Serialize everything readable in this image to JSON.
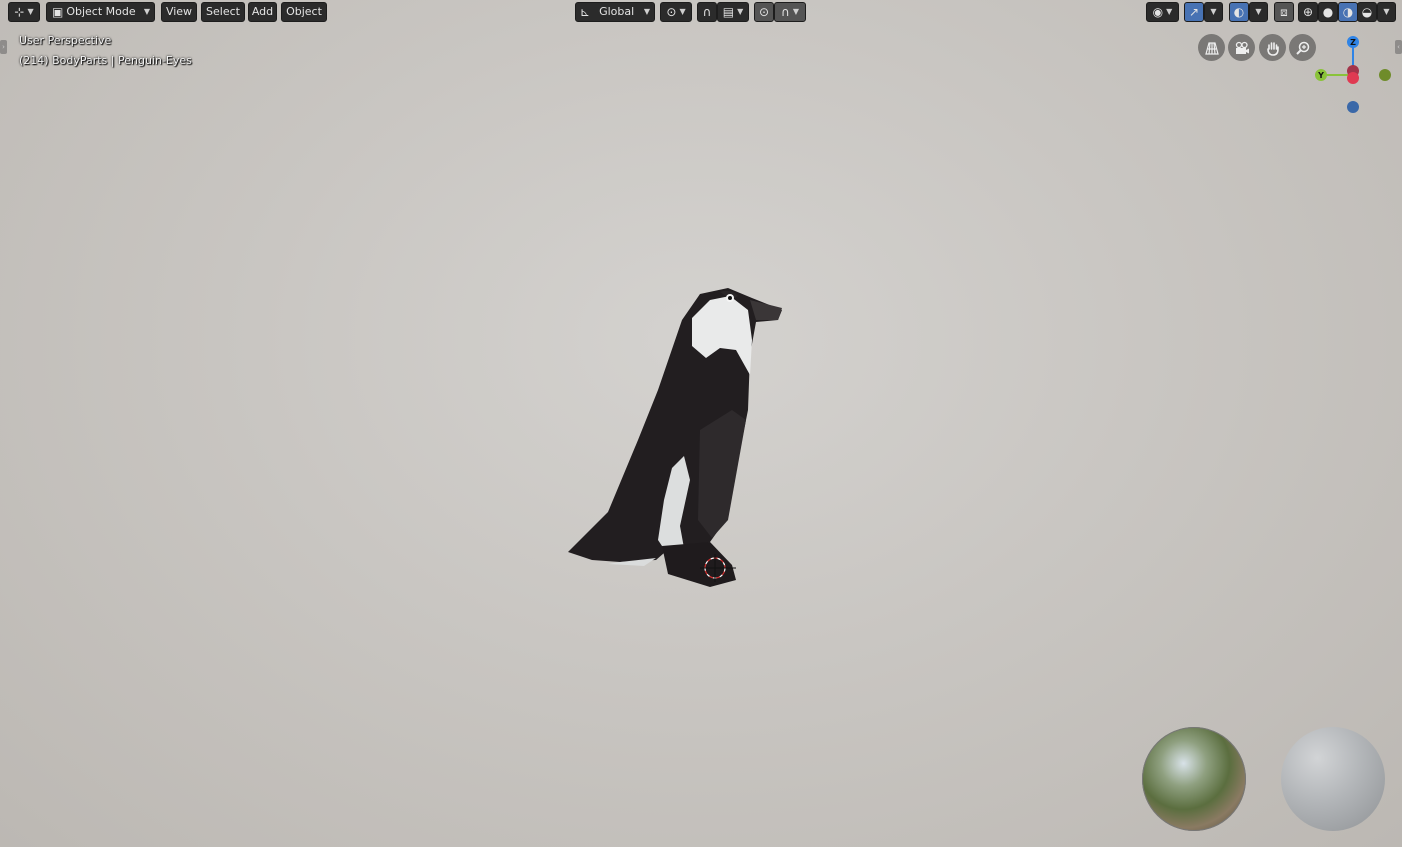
{
  "header": {
    "editor_type_icon": "axes-icon",
    "mode_label": "Object Mode",
    "menus": [
      "View",
      "Select",
      "Add",
      "Object"
    ],
    "transform_orientation": "Global"
  },
  "overlay": {
    "perspective_label": "User Perspective",
    "object_info": "(214) BodyParts | Penguin-Eyes"
  },
  "gizmo": {
    "z_label": "Z",
    "y_label": "Y",
    "colors": {
      "x": "#e03a52",
      "y": "#8ac33a",
      "z": "#2f84e6",
      "neg_y": "#6f8c2a",
      "neg_z": "#3a68a8"
    }
  },
  "viewport_icons": [
    "grid-view-icon",
    "camera-icon",
    "hand-pan-icon",
    "zoom-icon"
  ],
  "scene": {
    "object": "penguin",
    "background": "#c9c6c2"
  },
  "accent_color": "#4772b3"
}
